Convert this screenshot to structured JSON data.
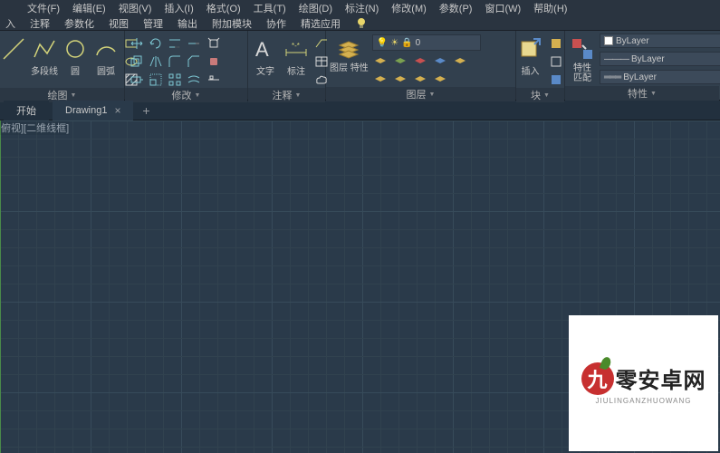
{
  "menus": {
    "file": "文件(F)",
    "edit": "编辑(E)",
    "view": "视图(V)",
    "insert": "插入(I)",
    "format": "格式(O)",
    "tools": "工具(T)",
    "draw": "绘图(D)",
    "dimension": "标注(N)",
    "modify": "修改(M)",
    "param": "参数(P)",
    "window": "窗口(W)",
    "help": "帮助(H)"
  },
  "ribbon_tabs": {
    "t1": "入",
    "t2": "注释",
    "t3": "参数化",
    "t4": "视图",
    "t5": "管理",
    "t6": "输出",
    "t7": "附加模块",
    "t8": "协作",
    "t9": "精选应用"
  },
  "panels": {
    "draw": {
      "title": "绘图",
      "polyline": "多段线",
      "circle": "圆",
      "arc": "圆弧"
    },
    "modify": {
      "title": "修改"
    },
    "annotation": {
      "title": "注释",
      "text": "文字",
      "dimension": "标注"
    },
    "layers": {
      "title": "图层",
      "props": "图层\n特性",
      "current": "0"
    },
    "block": {
      "title": "块",
      "insert": "插入"
    },
    "properties": {
      "title": "特性",
      "match": "特性\n匹配",
      "bylayer1": "ByLayer",
      "bylayer2": "ByLayer",
      "bylayer3": "ByLayer"
    }
  },
  "doctabs": {
    "start": "开始",
    "drawing": "Drawing1"
  },
  "canvas": {
    "viewlabel": "俯视][二维线框]"
  },
  "watermark": {
    "brand_char": "九",
    "brand_text": "零安卓网",
    "sub": "JIULINGANZHUOWANG"
  }
}
